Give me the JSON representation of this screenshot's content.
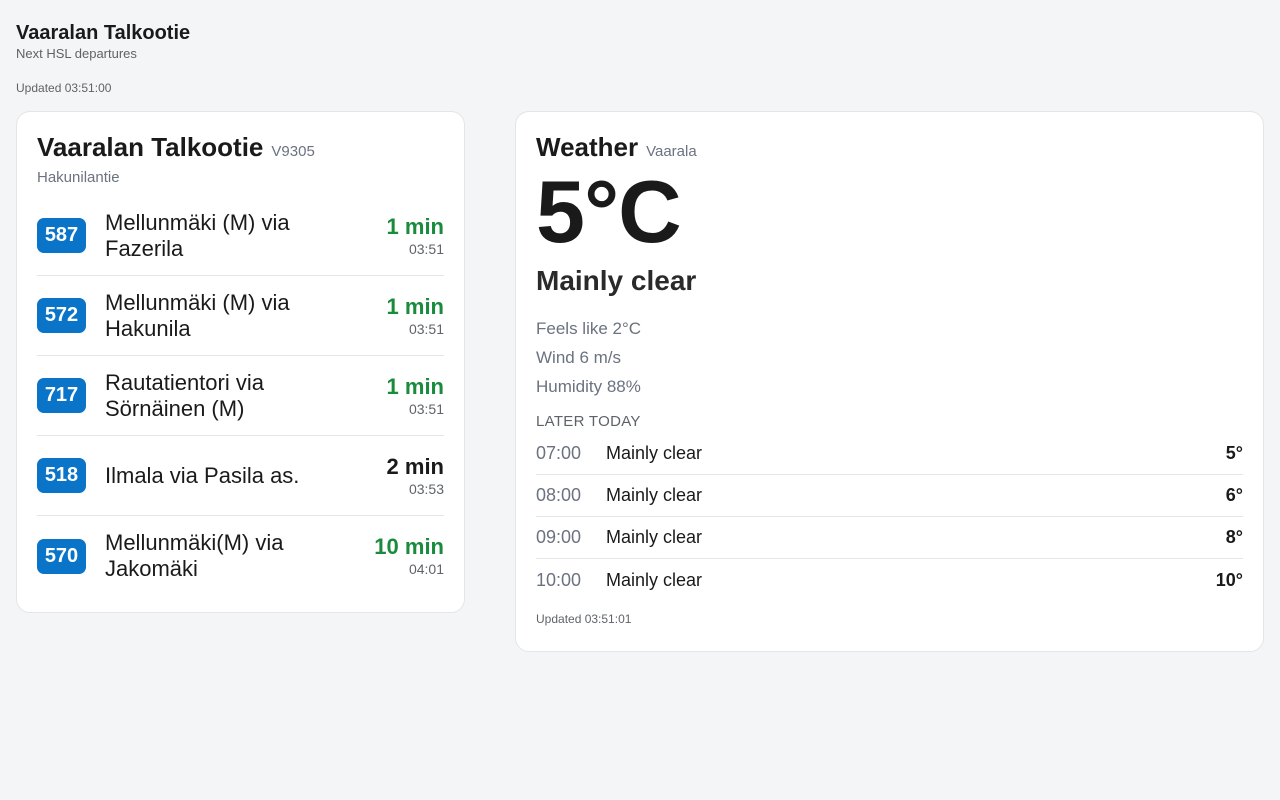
{
  "header": {
    "title": "Vaaralan Talkootie",
    "subtitle": "Next HSL departures",
    "updated": "Updated 03:51:00"
  },
  "stop": {
    "name": "Vaaralan Talkootie",
    "code": "V9305",
    "street": "Hakunilantie",
    "departures": [
      {
        "route": "587",
        "destination": "Mellunmäki (M) via Fazerila",
        "minutes": "1 min",
        "clock": "03:51",
        "realtime": true
      },
      {
        "route": "572",
        "destination": "Mellunmäki (M) via Hakunila",
        "minutes": "1 min",
        "clock": "03:51",
        "realtime": true
      },
      {
        "route": "717",
        "destination": "Rautatientori via Sörnäinen (M)",
        "minutes": "1 min",
        "clock": "03:51",
        "realtime": true
      },
      {
        "route": "518",
        "destination": "Ilmala via Pasila as.",
        "minutes": "2 min",
        "clock": "03:53",
        "realtime": false
      },
      {
        "route": "570",
        "destination": "Mellunmäki(M) via Jakomäki",
        "minutes": "10 min",
        "clock": "04:01",
        "realtime": true
      }
    ]
  },
  "weather": {
    "title": "Weather",
    "location": "Vaarala",
    "temperature": "5°C",
    "condition": "Mainly clear",
    "feels_like": "Feels like 2°C",
    "wind": "Wind 6 m/s",
    "humidity": "Humidity 88%",
    "later_label": "LATER TODAY",
    "forecast": [
      {
        "time": "07:00",
        "condition": "Mainly clear",
        "temp": "5°"
      },
      {
        "time": "08:00",
        "condition": "Mainly clear",
        "temp": "6°"
      },
      {
        "time": "09:00",
        "condition": "Mainly clear",
        "temp": "8°"
      },
      {
        "time": "10:00",
        "condition": "Mainly clear",
        "temp": "10°"
      }
    ],
    "updated": "Updated 03:51:01"
  },
  "colors": {
    "route_badge": "#0a74c8",
    "realtime": "#1a8a3d",
    "background": "#f4f5f7"
  }
}
